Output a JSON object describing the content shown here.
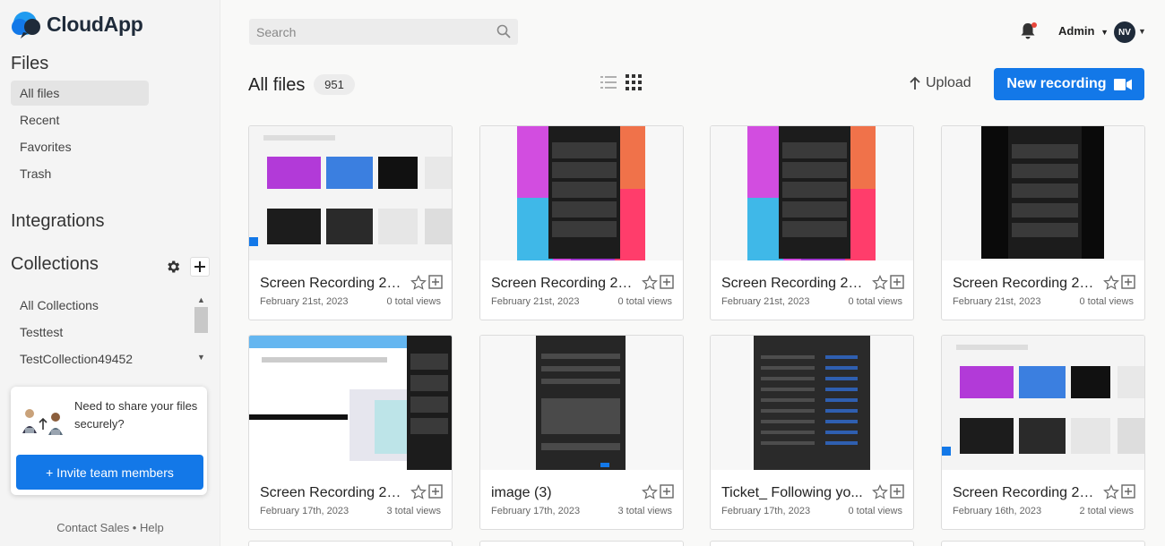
{
  "brand": {
    "name": "CloudApp"
  },
  "sidebar": {
    "files_title": "Files",
    "nav": [
      {
        "label": "All files",
        "active": true
      },
      {
        "label": "Recent"
      },
      {
        "label": "Favorites"
      },
      {
        "label": "Trash"
      }
    ],
    "integrations_title": "Integrations",
    "collections_title": "Collections",
    "collections": [
      {
        "label": "All Collections"
      },
      {
        "label": "Testtest"
      },
      {
        "label": "TestCollection49452"
      }
    ],
    "share": {
      "text": "Need to share your files securely?",
      "button": "+ Invite team members"
    },
    "footer": "Contact Sales • Help"
  },
  "topbar": {
    "search_placeholder": "Search",
    "admin_label": "Admin",
    "avatar_initials": "NV",
    "notification_dot_color": "#e8463b"
  },
  "header": {
    "title": "All files",
    "count": "951",
    "upload_label": "Upload",
    "new_recording_label": "New recording"
  },
  "colors": {
    "accent": "#1378e8",
    "brand_dark": "#1f2b3a"
  },
  "files": [
    {
      "title": "Screen Recording 20...",
      "date": "February 21st, 2023",
      "views": "0 total views",
      "thumb": "light-ui"
    },
    {
      "title": "Screen Recording 20...",
      "date": "February 21st, 2023",
      "views": "0 total views",
      "thumb": "gradient-dark"
    },
    {
      "title": "Screen Recording 20...",
      "date": "February 21st, 2023",
      "views": "0 total views",
      "thumb": "gradient-dark"
    },
    {
      "title": "Screen Recording 20...",
      "date": "February 21st, 2023",
      "views": "0 total views",
      "thumb": "black-ui"
    },
    {
      "title": "Screen Recording 20...",
      "date": "February 17th, 2023",
      "views": "3 total views",
      "thumb": "web-page"
    },
    {
      "title": "image (3)",
      "date": "February 17th, 2023",
      "views": "3 total views",
      "thumb": "settings-dark"
    },
    {
      "title": "Ticket_ Following yo...",
      "date": "February 17th, 2023",
      "views": "0 total views",
      "thumb": "list-dark"
    },
    {
      "title": "Screen Recording 20...",
      "date": "February 16th, 2023",
      "views": "2 total views",
      "thumb": "light-ui"
    }
  ]
}
